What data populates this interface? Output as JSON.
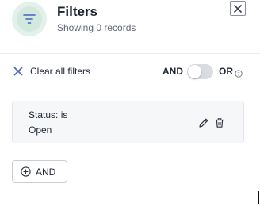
{
  "header": {
    "title": "Filters",
    "subtitle": "Showing 0 records",
    "icon": "filter-icon",
    "accent_color": "#4a5fc1",
    "avatar_color": "#e3f1ea"
  },
  "toolbar": {
    "clear_label": "Clear all filters",
    "and_label": "AND",
    "or_label": "OR",
    "toggle_state": "AND"
  },
  "conditions": [
    {
      "field_label": "Status: is",
      "value": "Open"
    }
  ],
  "actions": {
    "add_and_label": "AND"
  }
}
